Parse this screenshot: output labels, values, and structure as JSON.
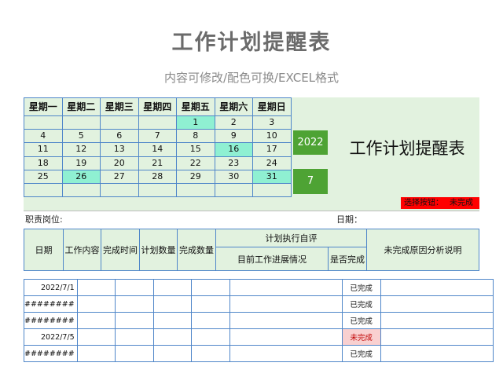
{
  "title": "工作计划提醒表",
  "subtitle": "内容可修改/配色可换/EXCEL格式",
  "calendar": {
    "weekdays": [
      "星期一",
      "星期二",
      "星期三",
      "星期四",
      "星期五",
      "星期六",
      "星期日"
    ],
    "weeks": [
      [
        "",
        "",
        "",
        "",
        "1",
        "2",
        "3"
      ],
      [
        "4",
        "5",
        "6",
        "7",
        "8",
        "9",
        "10"
      ],
      [
        "11",
        "12",
        "13",
        "14",
        "15",
        "16",
        "17"
      ],
      [
        "18",
        "19",
        "20",
        "21",
        "22",
        "23",
        "24"
      ],
      [
        "25",
        "26",
        "27",
        "28",
        "29",
        "30",
        "31"
      ],
      [
        "",
        "",
        "",
        "",
        "",
        "",
        ""
      ]
    ],
    "highlighted": [
      "1",
      "16",
      "26",
      "31"
    ],
    "year": "2022",
    "month": "7",
    "title": "工作计划提醒表",
    "select_label": "选择按钮：",
    "select_value": "未完成",
    "colors": {
      "green_fill": "#e2f2df",
      "highlight": "#8ff0d2",
      "year_box": "#4ea334",
      "select_bar": "#ff0000"
    }
  },
  "meta": {
    "position_label": "职责岗位:",
    "date_label": "日期："
  },
  "headers": {
    "date": "日期",
    "content": "工作内容",
    "done_time": "完成时间",
    "planned_qty": "计划数量",
    "done_qty": "完成数量",
    "self_eval": "计划执行自评",
    "progress": "目前工作进展情况",
    "is_done": "是否完成",
    "reason": "未完成原因分析说明"
  },
  "rows": [
    {
      "date": "2022/7/1",
      "status": "已完成"
    },
    {
      "date": "########",
      "status": "已完成"
    },
    {
      "date": "########",
      "status": "已完成"
    },
    {
      "date": "2022/7/5",
      "status": "未完成"
    },
    {
      "date": "########",
      "status": "已完成"
    }
  ]
}
